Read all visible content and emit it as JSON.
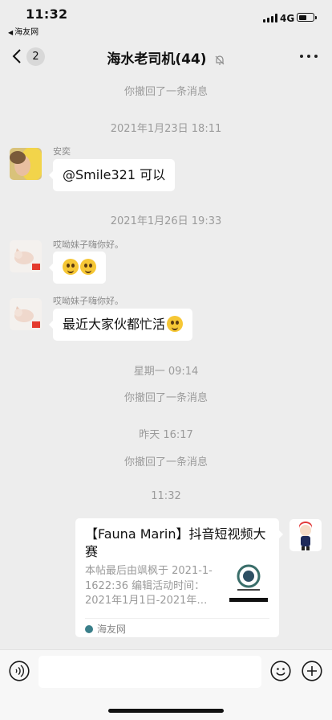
{
  "status_bar": {
    "time": "11:32",
    "back_app": "海友网",
    "network": "4G"
  },
  "nav": {
    "badge_count": "2",
    "title": "海水老司机(44)"
  },
  "messages": {
    "sys1": "你撤回了一条消息",
    "ts1": "2021年1月23日 18:11",
    "m1_sender": "安奕",
    "m1_text": "@Smile321 可以",
    "ts2": "2021年1月26日 19:33",
    "m2_sender": "哎呦妹子嗨你好。",
    "m3_sender": "哎呦妹子嗨你好。",
    "m3_text": "最近大家伙都忙活",
    "ts3": "星期一 09:14",
    "sys2": "你撤回了一条消息",
    "ts4": "昨天 16:17",
    "sys3": "你撤回了一条消息",
    "ts5": "11:32"
  },
  "card": {
    "title": "【Fauna Marin】抖音短视频大赛",
    "desc": "本帖最后由飒枫于 2021-1-1622:36 编辑活动时间：2021年1月1日-2021年…",
    "source": "海友网"
  },
  "input": {
    "placeholder": ""
  },
  "colors": {
    "background": "#EDEDED",
    "bubble": "#FFFFFF",
    "system_text": "#9B9B9B"
  }
}
